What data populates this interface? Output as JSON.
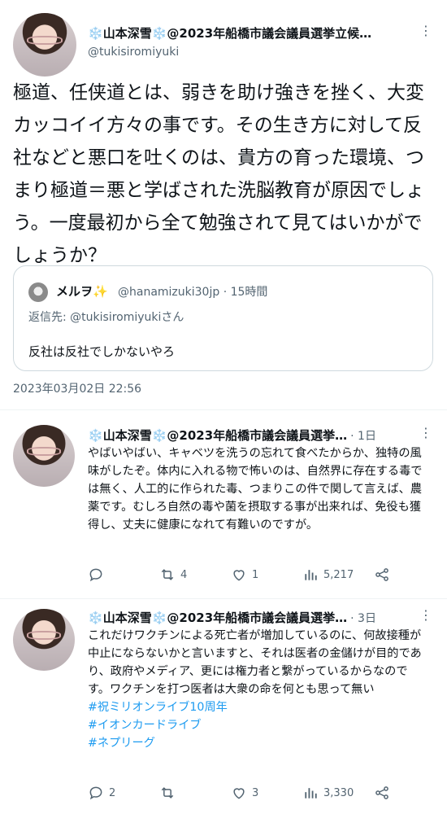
{
  "main_tweet": {
    "author_name": "山本深雪",
    "author_suffix": "@2023年船橋市議会議員選挙立候…",
    "snowflake": "❄️",
    "handle": "@tukisiromiyuki",
    "text": "極道、任侠道とは、弱きを助け強きを挫く、大変カッコイイ方々の事です。その生き方に対して反社などと悪口を吐くのは、貴方の育った環境、つまり極道＝悪と学ばされた洗脳教育が原因でしょう。一度最初から全て勉強されて見てはいかがでしょうか？",
    "timestamp": "2023年03月02日 22:56",
    "quote": {
      "name": "メルヲ✨",
      "handle_time": "@hanamizuki30jp · 15時間",
      "reply_to": "返信先: @tukisiromiyukiさん",
      "text": "反社は反社でしかないやろ"
    }
  },
  "posts": [
    {
      "author_name": "山本深雪",
      "author_suffix": "@2023年船橋市議会議員選挙…",
      "time": "· 1日",
      "text": "やばいやばい、キャベツを洗うの忘れて食べたからか、独特の風味がしたぞ。体内に入れる物で怖いのは、自然界に存在する毒では無く、人工的に作られた毒、つまりこの件で関して言えば、農薬です。むしろ自然の毒や菌を摂取する事が出来れば、免役も獲得し、丈夫に健康になれて有難いのですが。",
      "replies": "",
      "retweets": "4",
      "likes": "1",
      "views": "5,217"
    },
    {
      "author_name": "山本深雪",
      "author_suffix": "@2023年船橋市議会議員選挙…",
      "time": "· 3日",
      "text": "これだけワクチンによる死亡者が増加しているのに、何故接種が中止にならないかと言いますと、それは医者の金儲けが目的であり、政府やメディア、更には権力者と繋がっているからなのです。ワクチンを打つ医者は大衆の命を何とも思って無い",
      "hashtags": [
        "#祝ミリオンライブ10周年",
        "#イオンカードライブ",
        "#ネプリーグ"
      ],
      "replies": "2",
      "retweets": "",
      "likes": "3",
      "views": "3,330"
    }
  ]
}
